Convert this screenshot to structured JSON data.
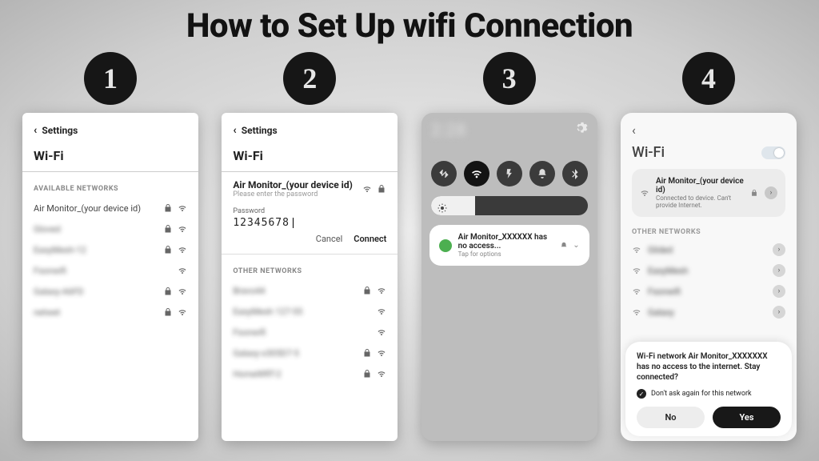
{
  "headline": "How to Set Up wifi Connection",
  "steps": [
    "1",
    "2",
    "3",
    "4"
  ],
  "screen1": {
    "back": "Settings",
    "title": "Wi-Fi",
    "section": "AVAILABLE NETWORKS",
    "networks": [
      {
        "name": "Air Monitor_(your device id)",
        "locked": true,
        "blur": false
      },
      {
        "name": "Gloved",
        "locked": true,
        "blur": true
      },
      {
        "name": "EasyMesh-12",
        "locked": true,
        "blur": true
      },
      {
        "name": "Fsonwifi",
        "locked": false,
        "blur": true
      },
      {
        "name": "Galaxy-A6FD",
        "locked": true,
        "blur": true
      },
      {
        "name": "netwet",
        "locked": true,
        "blur": true
      }
    ]
  },
  "screen2": {
    "back": "Settings",
    "title": "Wi-Fi",
    "network": "Air Monitor_(your device id)",
    "hint": "Please enter the password",
    "pw_label": "Password",
    "pw_value": "12345678",
    "cancel": "Cancel",
    "connect": "Connect",
    "section": "OTHER NETWORKS",
    "others": [
      {
        "name": "Bravo44",
        "locked": true,
        "blur": true
      },
      {
        "name": "EasyMesh 127-55",
        "locked": false,
        "blur": true
      },
      {
        "name": "Fsonwifi",
        "locked": false,
        "blur": true
      },
      {
        "name": "Galaxy-x305D7-5",
        "locked": true,
        "blur": true
      },
      {
        "name": "HomeWRT-2",
        "locked": true,
        "blur": true
      }
    ]
  },
  "screen3": {
    "time": "2:28",
    "notif_title": "Air Monitor_XXXXXX has no access...",
    "notif_sub": "Tap for options"
  },
  "screen4": {
    "title": "Wi-Fi",
    "conn_name": "Air Monitor_(your device id)",
    "conn_status": "Connected to device. Can't provide Internet.",
    "section": "OTHER NETWORKS",
    "others": [
      {
        "name": "Glided"
      },
      {
        "name": "EasyMesh"
      },
      {
        "name": "Fsonwifi"
      },
      {
        "name": "Galaxy"
      }
    ],
    "sheet_msg": "Wi-Fi network Air Monitor_XXXXXXX has no access to the internet. Stay connected?",
    "sheet_ask": "Don't ask again for this network",
    "no": "No",
    "yes": "Yes"
  }
}
